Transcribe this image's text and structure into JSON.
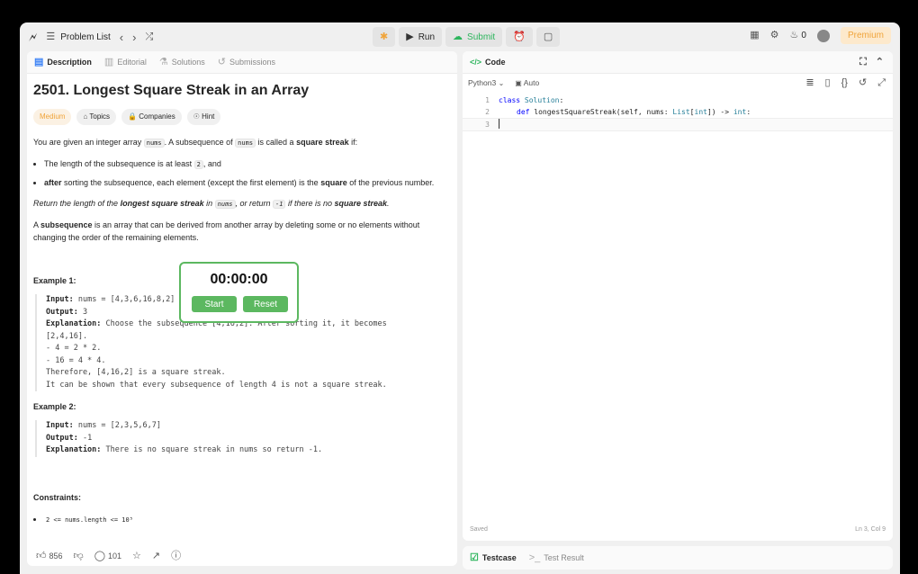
{
  "topbar": {
    "problem_list": "Problem List",
    "run": "Run",
    "submit": "Submit",
    "streak_count": "0",
    "premium": "Premium"
  },
  "left_tabs": [
    "Description",
    "Editorial",
    "Solutions",
    "Submissions"
  ],
  "problem": {
    "title": "2501. Longest Square Streak in an Array",
    "difficulty": "Medium",
    "tags": [
      "Topics",
      "Companies",
      "Hint"
    ],
    "intro_a": "You are given an integer array ",
    "intro_code": "nums",
    "intro_b": ". A subsequence of ",
    "intro_code2": "nums",
    "intro_c": " is called a ",
    "intro_bold": "square streak",
    "intro_d": " if:",
    "bullet1_a": "The length of the subsequence is at least ",
    "bullet1_code": "2",
    "bullet1_b": ", and",
    "bullet2_bold": "after",
    "bullet2_a": " sorting the subsequence, each element (except the first element) is the ",
    "bullet2_bold2": "square",
    "bullet2_b": " of the previous number.",
    "return_a": "Return the length of the ",
    "return_bold": "longest square streak",
    "return_b": " in ",
    "return_code": "nums",
    "return_c": ", or return ",
    "return_code2": "-1",
    "return_d": " if there is no ",
    "return_bold2": "square streak",
    "return_e": ".",
    "subseq_bold": "subsequence",
    "subseq_a": "A ",
    "subseq_b": " is an array that can be derived from another array by deleting some or no elements without changing the order of the remaining elements.",
    "example1_title": "Example 1:",
    "example1_lines": [
      "Input: nums = [4,3,6,16,8,2]",
      "Output: 3",
      "Explanation: Choose the subsequence [4,16,2]. After sorting it, it becomes",
      "[2,4,16].",
      "- 4 = 2 * 2.",
      "- 16 = 4 * 4.",
      "Therefore, [4,16,2] is a square streak.",
      "It can be shown that every subsequence of length 4 is not a square streak."
    ],
    "example2_title": "Example 2:",
    "example2_lines": [
      "Input: nums = [2,3,5,6,7]",
      "Output: -1",
      "Explanation: There is no square streak in nums so return -1."
    ],
    "constraints_title": "Constraints:",
    "constraint1": "2 <= nums.length <= 10⁵"
  },
  "footer": {
    "likes": "856",
    "comments": "101"
  },
  "timer": {
    "time": "00:00:00",
    "start": "Start",
    "reset": "Reset"
  },
  "code": {
    "header": "Code",
    "language": "Python3",
    "auto": "Auto",
    "lines": [
      {
        "n": "1",
        "text": "class Solution:"
      },
      {
        "n": "2",
        "text": "def longestSquareStreak(self, nums: List[int]) -> int:"
      },
      {
        "n": "3",
        "text": ""
      }
    ],
    "saved": "Saved",
    "cursor_pos": "Ln 3, Col 9"
  },
  "bottom_tabs": [
    "Testcase",
    "Test Result"
  ]
}
